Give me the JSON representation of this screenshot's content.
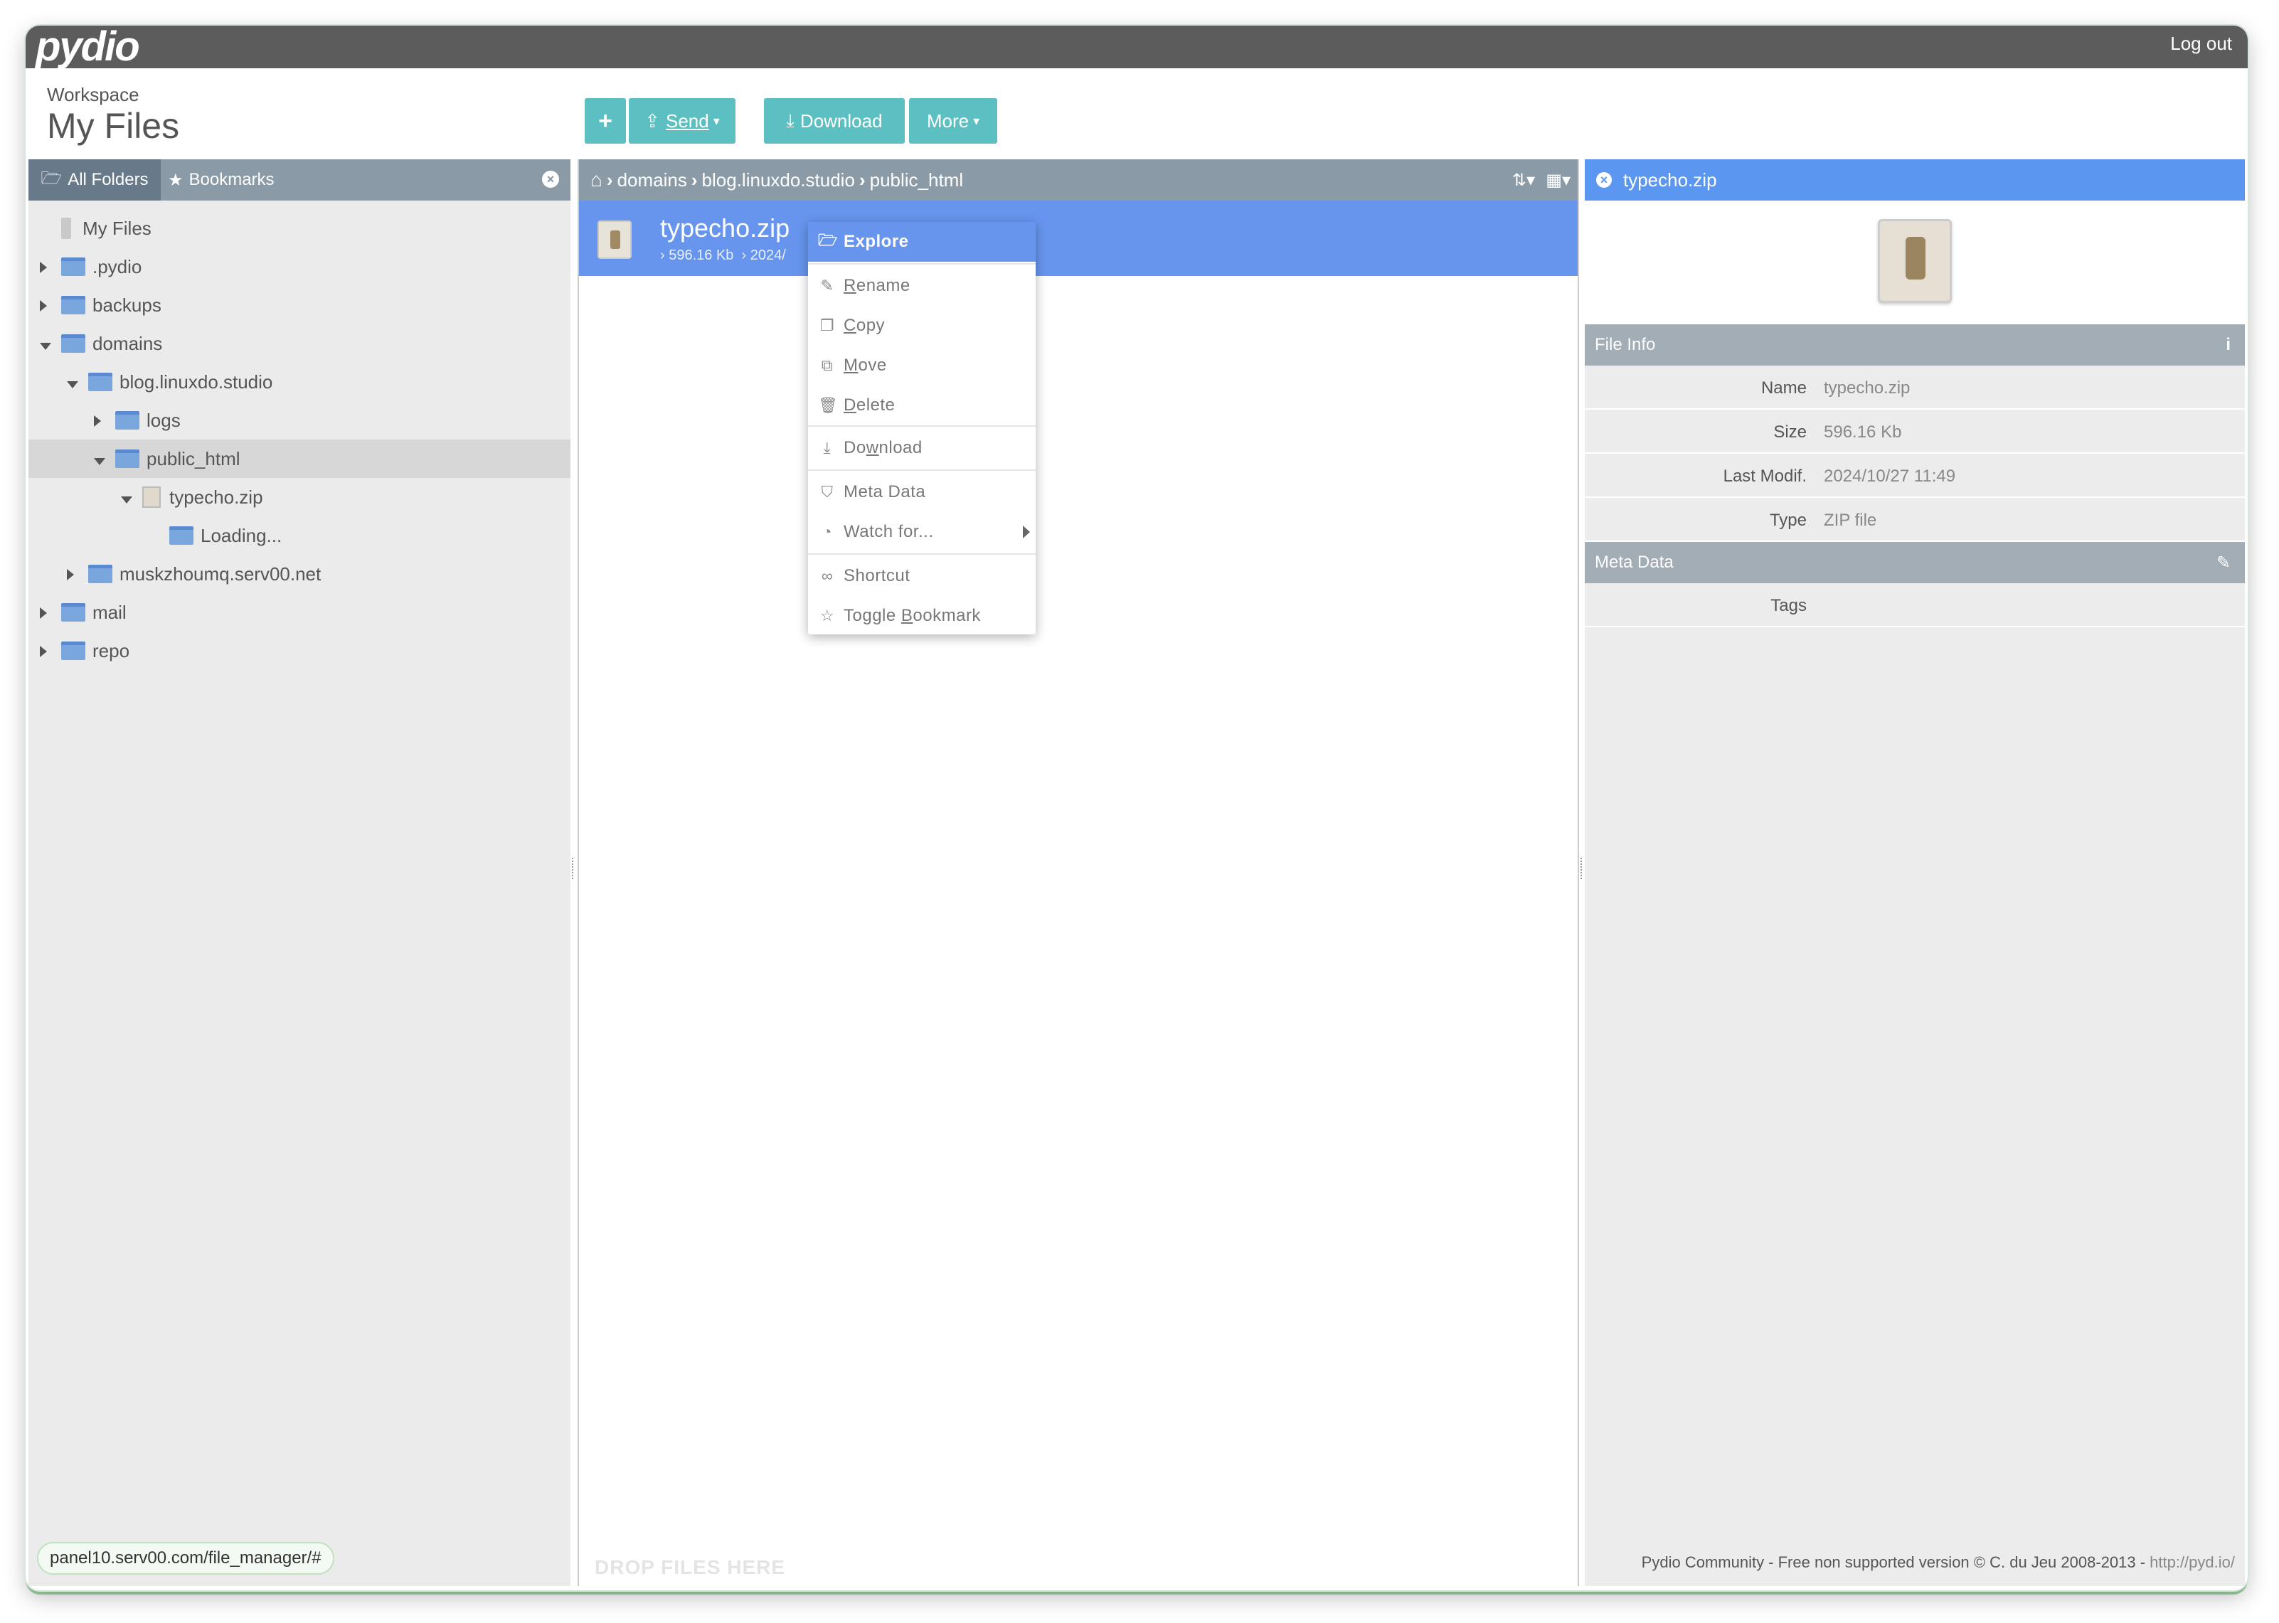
{
  "app": {
    "logo": "pydio",
    "logout": "Log out"
  },
  "workspace": {
    "label": "Workspace",
    "title": "My Files"
  },
  "toolbar": {
    "add": "+",
    "send": "Send",
    "download": "Download",
    "more": "More"
  },
  "left_tabs": {
    "all_folders": "All Folders",
    "bookmarks": "Bookmarks"
  },
  "tree": [
    {
      "label": "My Files",
      "depth": 0,
      "caret": "none",
      "kind": "root"
    },
    {
      "label": ".pydio",
      "depth": 0,
      "caret": "right",
      "kind": "folder"
    },
    {
      "label": "backups",
      "depth": 0,
      "caret": "right",
      "kind": "folder"
    },
    {
      "label": "domains",
      "depth": 0,
      "caret": "down",
      "kind": "folder"
    },
    {
      "label": "blog.linuxdo.studio",
      "depth": 1,
      "caret": "down",
      "kind": "folder"
    },
    {
      "label": "logs",
      "depth": 2,
      "caret": "right",
      "kind": "folder"
    },
    {
      "label": "public_html",
      "depth": 2,
      "caret": "down",
      "kind": "folder",
      "selected": true
    },
    {
      "label": "typecho.zip",
      "depth": 3,
      "caret": "down",
      "kind": "zip"
    },
    {
      "label": "Loading...",
      "depth": 4,
      "caret": "none",
      "kind": "folder"
    },
    {
      "label": "muskzhoumq.serv00.net",
      "depth": 1,
      "caret": "right",
      "kind": "folder"
    },
    {
      "label": "mail",
      "depth": 0,
      "caret": "right",
      "kind": "folder"
    },
    {
      "label": "repo",
      "depth": 0,
      "caret": "right",
      "kind": "folder"
    }
  ],
  "breadcrumb": [
    "domains",
    "blog.linuxdo.studio",
    "public_html"
  ],
  "file": {
    "name": "typecho.zip",
    "meta_size": "596.16 Kb",
    "meta_date_partial": "2024/"
  },
  "context_menu": [
    {
      "label": "Explore",
      "icon": "folder-open-icon",
      "active": true
    },
    {
      "label": "Rename",
      "icon": "pencil-icon"
    },
    {
      "label": "Copy",
      "icon": "copy-icon"
    },
    {
      "label": "Move",
      "icon": "move-icon"
    },
    {
      "label": "Delete",
      "icon": "trash-icon"
    },
    {
      "label": "Download",
      "icon": "download-icon"
    },
    {
      "label": "Meta Data",
      "icon": "tags-icon"
    },
    {
      "label": "Watch for...",
      "icon": "rss-icon",
      "submenu": true
    },
    {
      "label": "Shortcut",
      "icon": "link-icon"
    },
    {
      "label": "Toggle Bookmark",
      "icon": "star-icon"
    }
  ],
  "right_panel": {
    "title": "typecho.zip",
    "file_info_title": "File Info",
    "file_info": [
      {
        "key": "Name",
        "value": "typecho.zip"
      },
      {
        "key": "Size",
        "value": "596.16 Kb"
      },
      {
        "key": "Last Modif.",
        "value": "2024/10/27 11:49"
      },
      {
        "key": "Type",
        "value": "ZIP file"
      }
    ],
    "meta_title": "Meta Data",
    "meta": [
      {
        "key": "Tags",
        "value": ""
      }
    ]
  },
  "drop_hint": "DROP FILES HERE",
  "footer": {
    "text": "Pydio Community - Free non supported version © C. du Jeu 2008-2013 - ",
    "link": "http://pyd.io/"
  },
  "status_url": "panel10.serv00.com/file_manager/#"
}
